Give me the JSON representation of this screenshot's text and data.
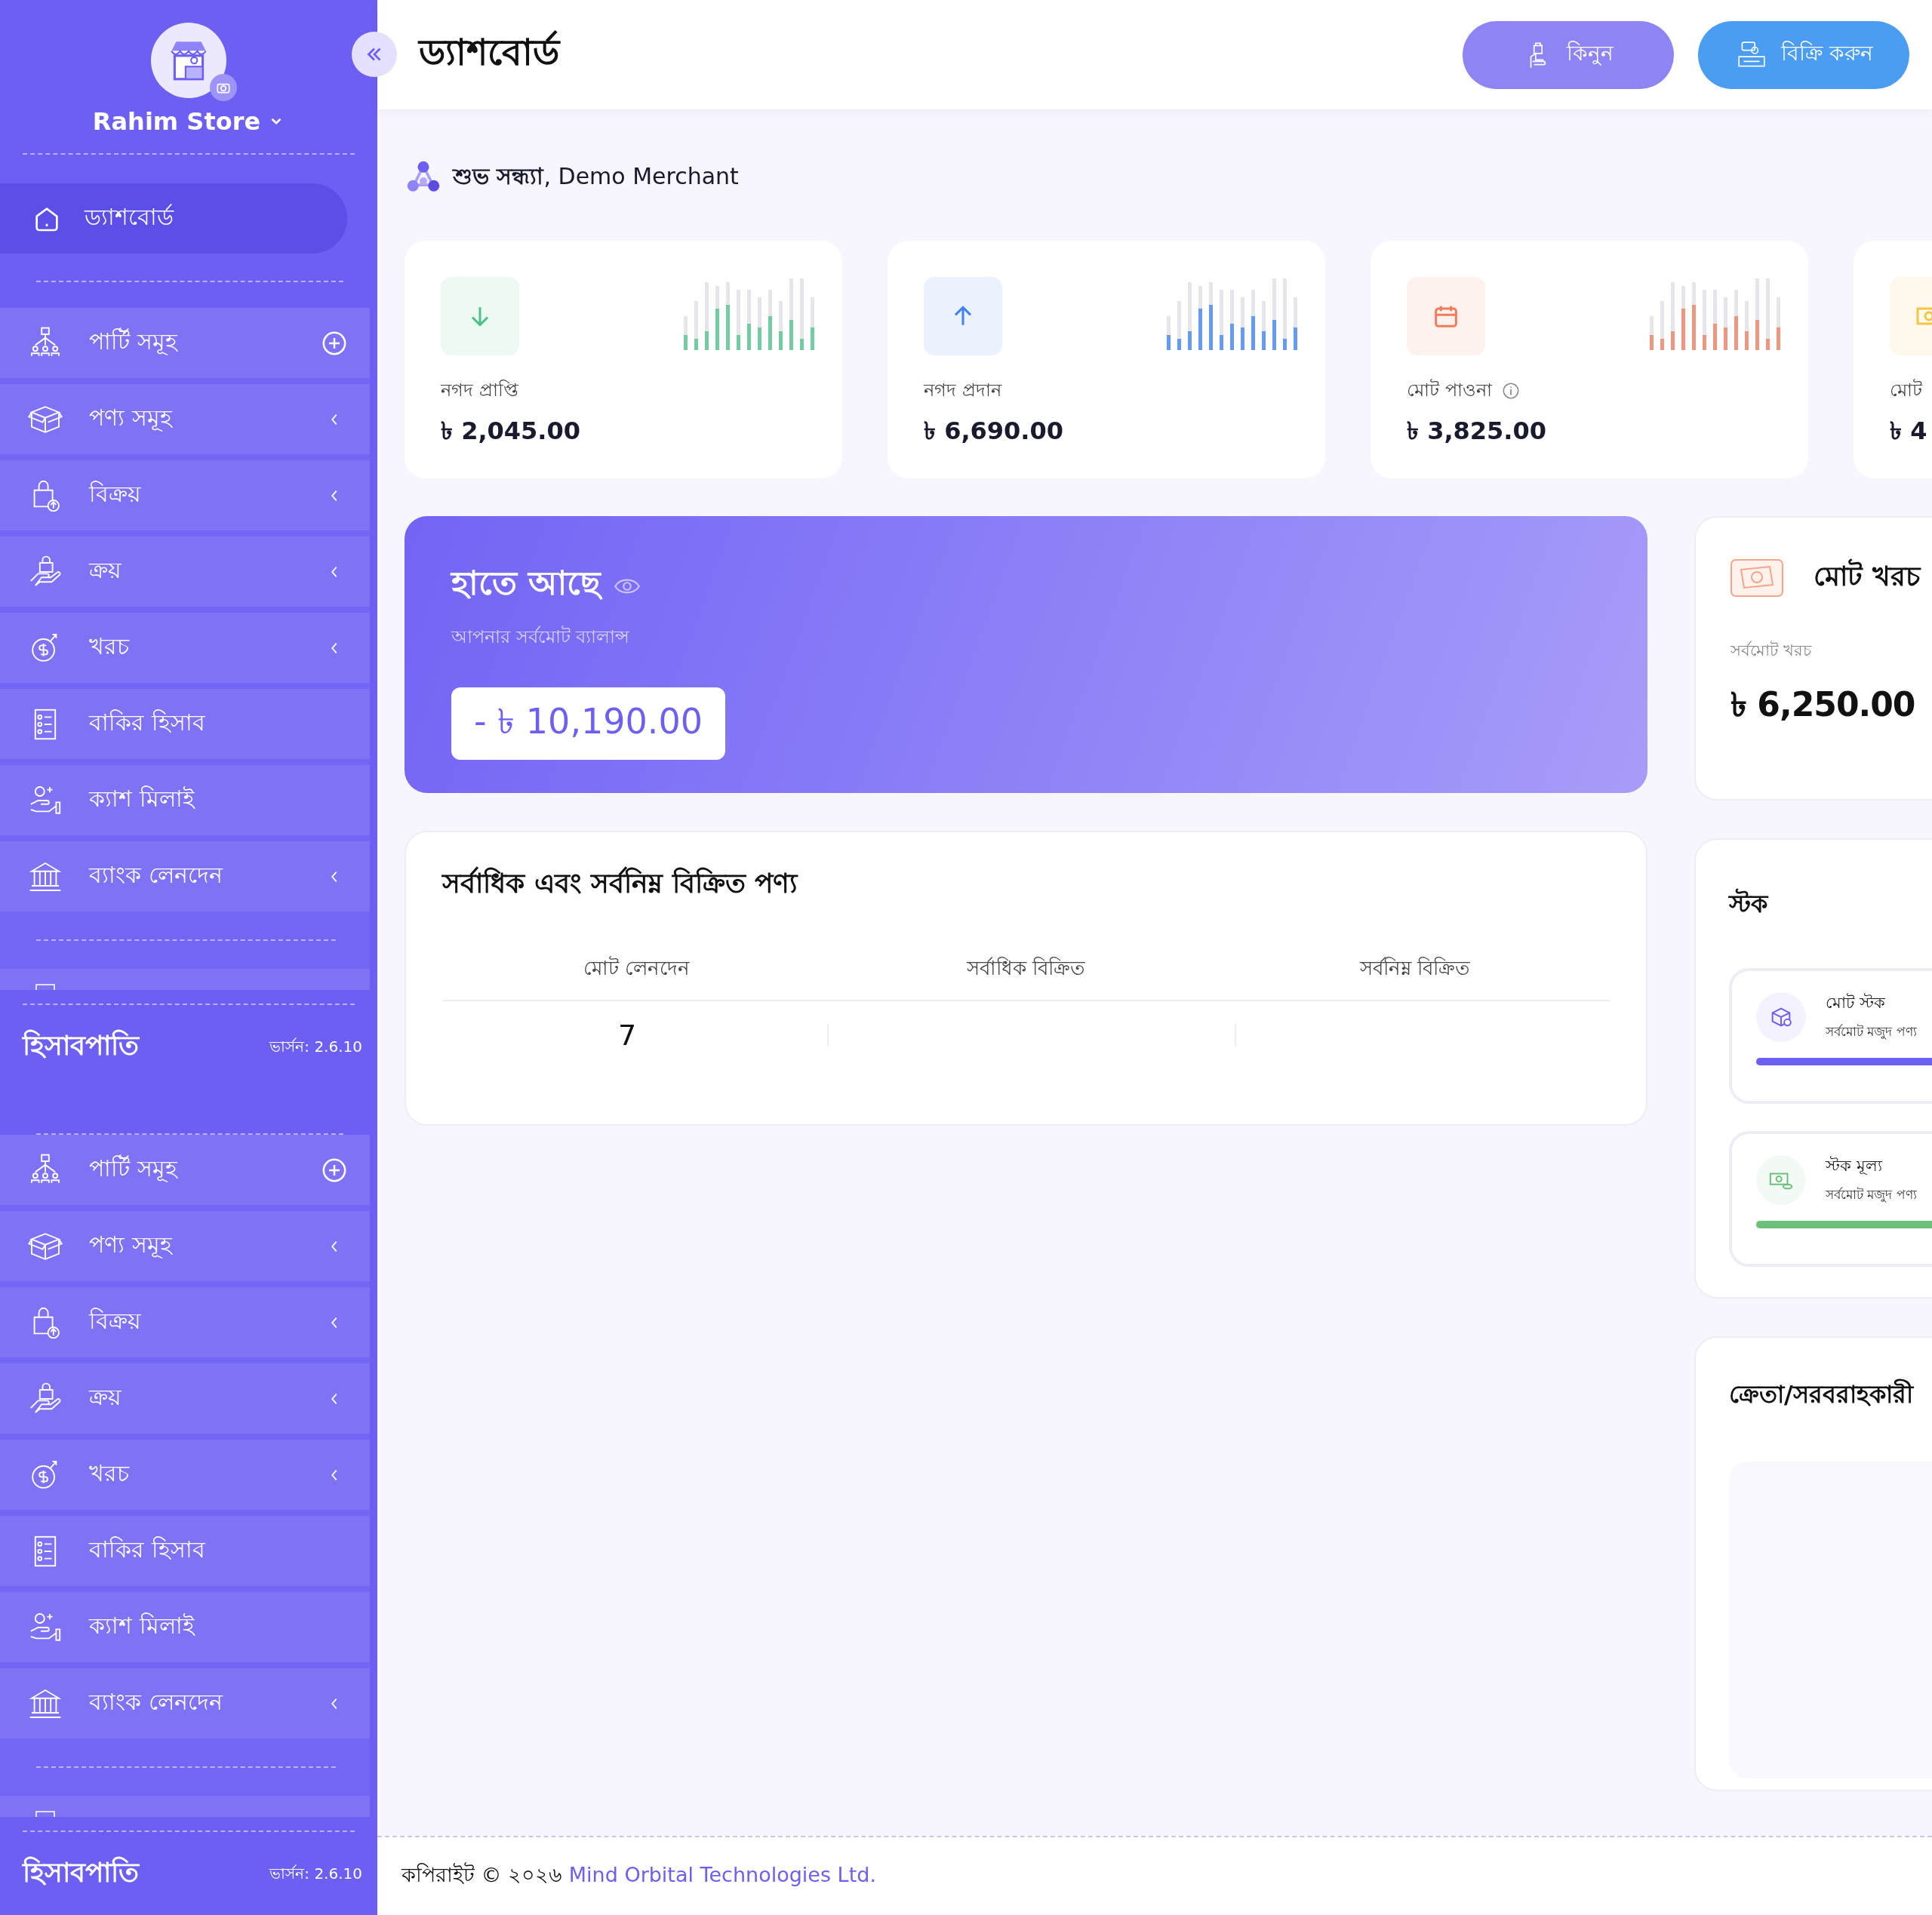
{
  "sidebar": {
    "store_name": "Rahim Store",
    "home_item": {
      "label": "ড্যাশবোর্ড",
      "selected": true
    },
    "blocks": [
      {
        "items": [
          {
            "kind": "party",
            "label": "পার্টি সমূহ",
            "addable": true,
            "expandable": false,
            "selected": false
          },
          {
            "kind": "product",
            "label": "পণ্য সমূহ",
            "addable": false,
            "expandable": true,
            "selected": false
          },
          {
            "kind": "sale",
            "label": "বিক্রয়",
            "addable": false,
            "expandable": true,
            "selected": false
          },
          {
            "kind": "purchase",
            "label": "ক্রয়",
            "addable": false,
            "expandable": true,
            "selected": false
          },
          {
            "kind": "expense",
            "label": "খরচ",
            "addable": false,
            "expandable": true,
            "selected": false
          },
          {
            "kind": "due",
            "label": "বাকির হিসাব",
            "addable": false,
            "expandable": false,
            "selected": false
          },
          {
            "kind": "cash",
            "label": "ক্যাশ মিলাই",
            "addable": false,
            "expandable": false,
            "selected": false
          },
          {
            "kind": "bank",
            "label": "ব্যাংক লেনদেন",
            "addable": false,
            "expandable": true,
            "selected": false
          }
        ],
        "brand": "হিসাবপাতি",
        "version": "ভার্সন: 2.6.10"
      },
      {
        "items": [
          {
            "kind": "party",
            "label": "পার্টি সমূহ",
            "addable": true,
            "expandable": false,
            "selected": false
          },
          {
            "kind": "product",
            "label": "পণ্য সমূহ",
            "addable": false,
            "expandable": true,
            "selected": false
          },
          {
            "kind": "sale",
            "label": "বিক্রয়",
            "addable": false,
            "expandable": true,
            "selected": false
          },
          {
            "kind": "purchase",
            "label": "ক্রয়",
            "addable": false,
            "expandable": true,
            "selected": false
          },
          {
            "kind": "expense",
            "label": "খরচ",
            "addable": false,
            "expandable": true,
            "selected": false
          },
          {
            "kind": "due",
            "label": "বাকির হিসাব",
            "addable": false,
            "expandable": false,
            "selected": false
          },
          {
            "kind": "cash",
            "label": "ক্যাশ মিলাই",
            "addable": false,
            "expandable": false,
            "selected": false
          },
          {
            "kind": "bank",
            "label": "ব্যাংক লেনদেন",
            "addable": false,
            "expandable": true,
            "selected": false
          }
        ],
        "brand": "হিসাবপাতি",
        "version": "ভার্সন: 2.6.10"
      }
    ]
  },
  "header": {
    "title": "ড্যাশবোর্ড",
    "buttons": [
      {
        "kind": "buy",
        "label": "কিনুন"
      },
      {
        "kind": "sell",
        "label": "বিক্রি করুন"
      }
    ]
  },
  "greeting": {
    "text": "**শুভ সন্ধ্যা**, Demo Merchant"
  },
  "stat_cards": [
    {
      "kind": "receive",
      "label": "নগদ প্রাপ্তি",
      "value": "৳ 2,045.00",
      "color": "#4cc28a",
      "info": false
    },
    {
      "kind": "pay",
      "label": "নগদ প্রদান",
      "value": "৳ 6,690.00",
      "color": "#3b82f6",
      "info": false
    },
    {
      "kind": "due",
      "label": "মোট পাওনা",
      "value": "৳ 3,825.00",
      "color": "#f07c5c",
      "info": true
    },
    {
      "kind": "other",
      "label": "মোট",
      "value": "৳ 4",
      "color": "#f5c542"
    }
  ],
  "balance": {
    "title": "হাতে আছে",
    "subtitle": "আপনার সর্বমোট ব্যালান্স",
    "amount": "- ৳ 10,190.00"
  },
  "products_table": {
    "title": "সর্বাধিক এবং সর্বনিম্ন বিক্রিত পণ্য",
    "columns": [
      "মোট লেনদেন",
      "সর্বাধিক বিক্রিত",
      "সর্বনিম্ন বিক্রিত"
    ],
    "rows": [
      {
        "total_transactions": "7"
      }
    ]
  },
  "expense_card": {
    "title": "মোট খরচ",
    "subtitle": "সর্বমোট খরচ",
    "amount": "৳ 6,250.00"
  },
  "stock_card": {
    "title": "স্টক",
    "items": [
      {
        "kind": "count",
        "label": "মোট স্টক",
        "caption": "সর্বমোট মজুদ পণ্য",
        "level": 1,
        "color": "#6c5ff2"
      },
      {
        "kind": "value",
        "label": "স্টক মূল্য",
        "caption": "সর্বমোট মজুদ পণ্য",
        "level": 1,
        "color": "#6cc07a"
      }
    ]
  },
  "party_card": {
    "title": "ক্রেতা/সরবরাহকারী"
  },
  "footer": {
    "copyright": "কপিরাইট © ২০২৬",
    "company": "Mind Orbital Technologies Ltd."
  }
}
